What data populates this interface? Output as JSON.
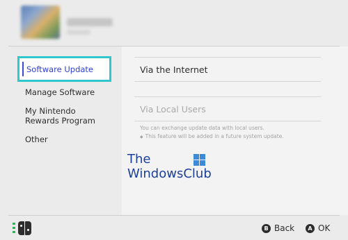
{
  "header": {
    "avatar_icon": "user-avatar-icon",
    "username_blurred": true
  },
  "sidebar": {
    "items": [
      {
        "label": "Software Update",
        "selected": true
      },
      {
        "label": "Manage Software"
      },
      {
        "label": "My Nintendo\nRewards Program"
      },
      {
        "label": "Other"
      }
    ]
  },
  "content": {
    "via_internet": "Via the Internet",
    "via_local_users": "Via Local Users",
    "note_line1": "You can exchange update data with local users.",
    "note_line2": "This feature will be added in a future system update.",
    "note_bullet": "◆"
  },
  "watermark": {
    "line1": "The",
    "line2": "WindowsClub",
    "icon": "windows-logo-icon",
    "color": "#1c3f99"
  },
  "footer": {
    "controller_icon": "joy-con-icon",
    "back_key": "B",
    "back_label": "Back",
    "ok_key": "A",
    "ok_label": "OK"
  },
  "colors": {
    "selection_border": "#2fc6cc",
    "selection_text": "#2e3fd0"
  }
}
